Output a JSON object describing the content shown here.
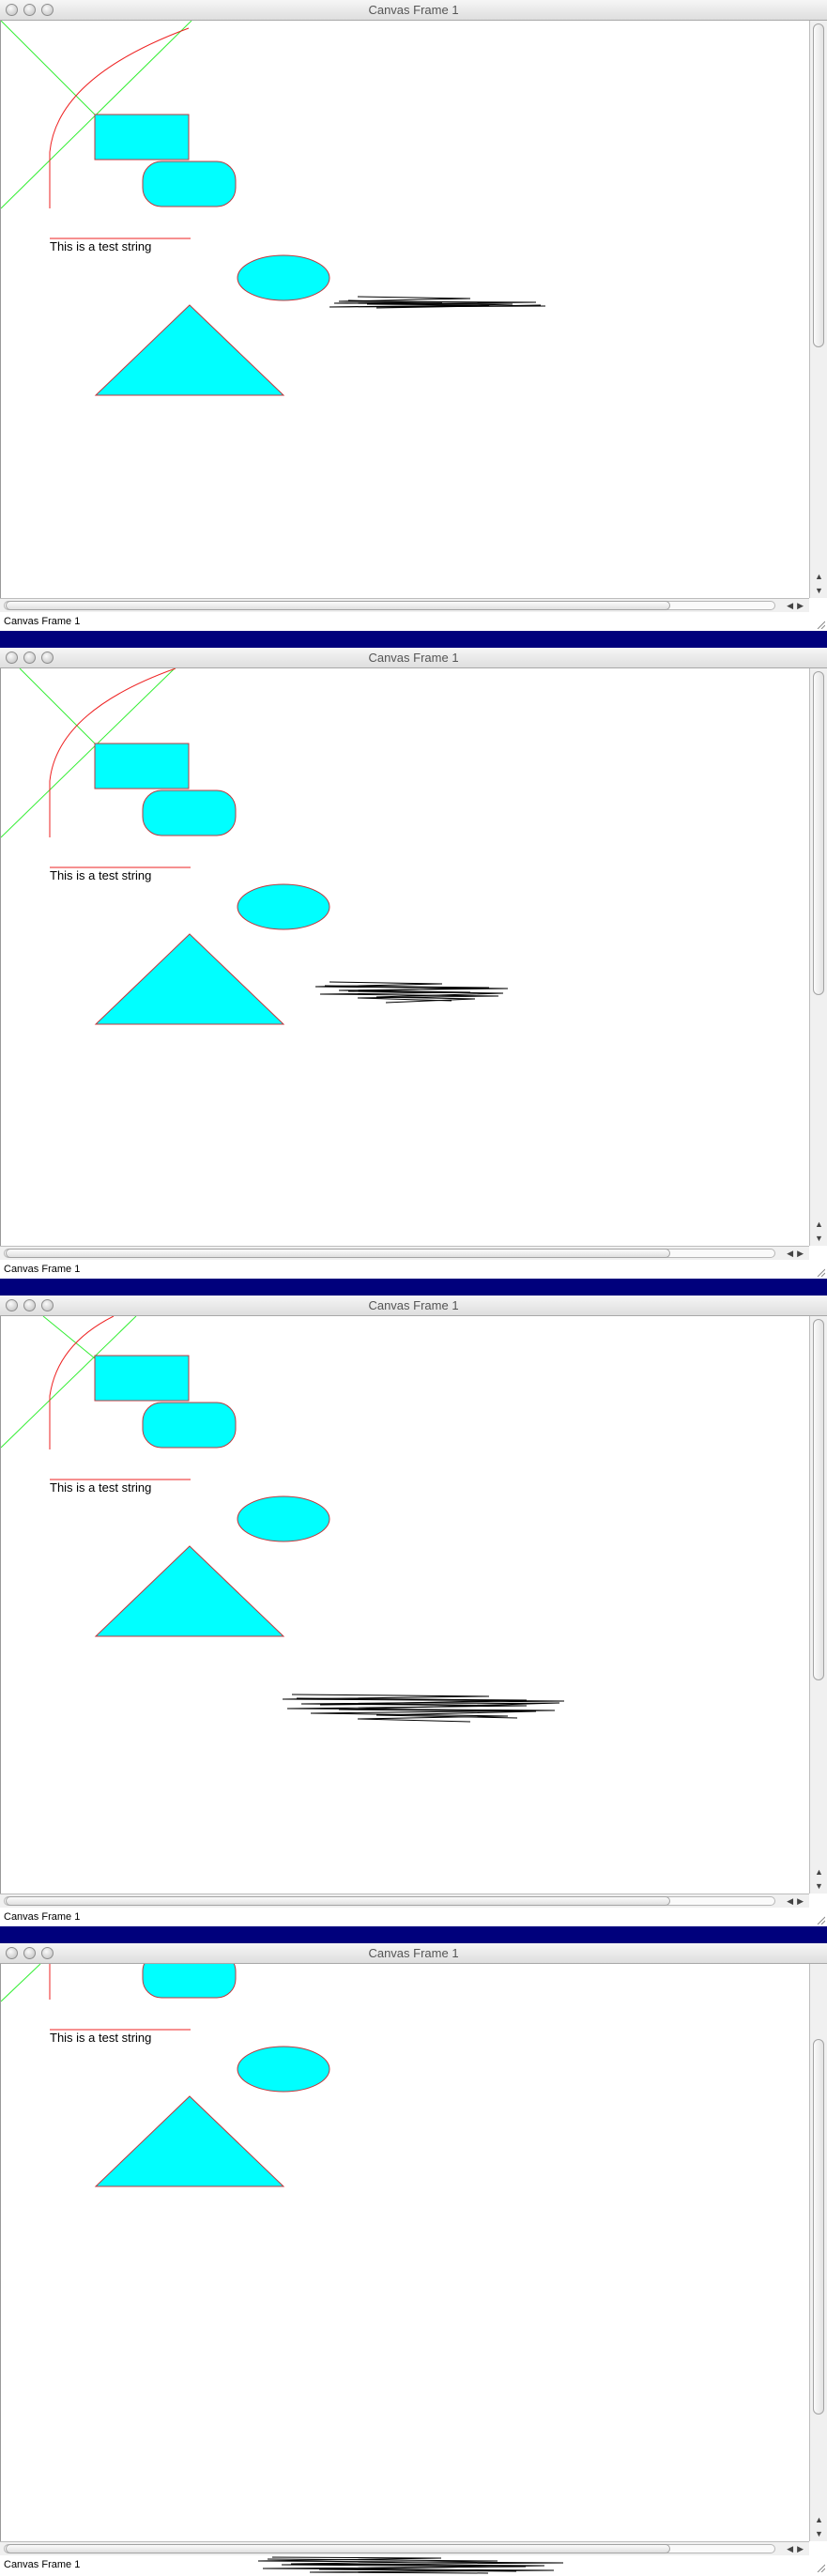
{
  "window_title": "Canvas Frame 1",
  "status_label": "Canvas Frame 1",
  "canvas_text": "This is a test string",
  "colors": {
    "shape_fill": "#00ffff",
    "shape_stroke": "#c1373d",
    "green_line": "#33ee33",
    "red_curve": "#ee2222",
    "separator": "#00007c"
  },
  "scroll_arrows": {
    "up": "▲",
    "down": "▼",
    "left": "◀",
    "right": "▶"
  }
}
